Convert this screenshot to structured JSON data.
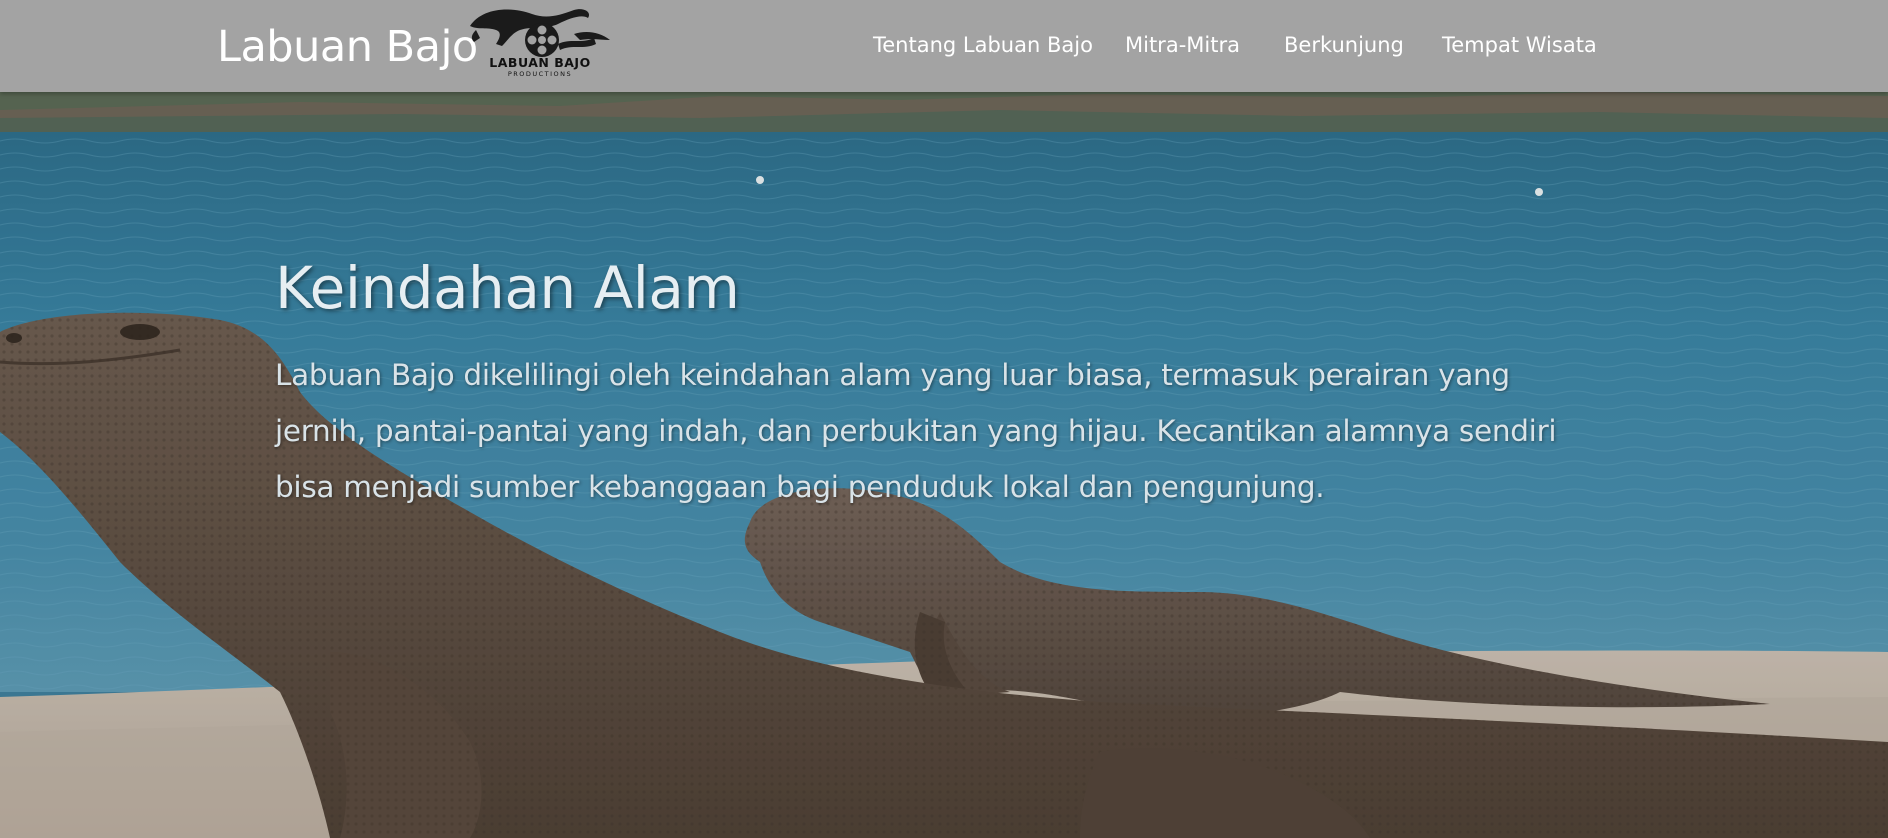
{
  "navbar": {
    "brand": "Labuan Bajo",
    "logo_text": "LABUAN BAJO",
    "logo_subtext": "PRODUCTIONS",
    "links": [
      "Tentang Labuan Bajo",
      "Mitra-Mitra",
      "Berkunjung",
      "Tempat Wisata"
    ]
  },
  "hero": {
    "title": "Keindahan Alam",
    "description": "Labuan Bajo dikelilingi oleh keindahan alam yang luar biasa, termasuk perairan yang jernih, pantai-pantai yang indah, dan perbukitan yang hijau. Kecantikan alamnya sendiri bisa menjadi sumber kebanggaan bagi penduduk lokal dan pengunjung."
  },
  "colors": {
    "navbar_bg": "#a3a3a3",
    "nav_text": "#ffffff",
    "sea": "#3f7f9c",
    "sand": "#cbbfb1",
    "komodo": "#6b5a4b"
  }
}
